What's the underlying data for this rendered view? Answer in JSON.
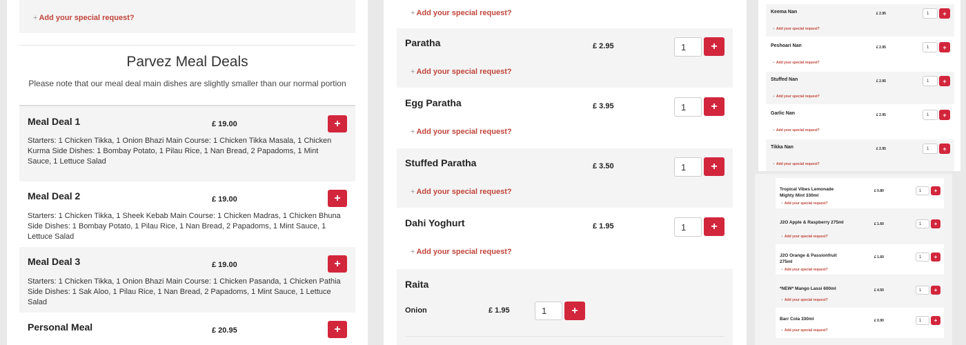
{
  "common": {
    "special_request": "Add your special request?",
    "plus_glyph": "+",
    "add_glyph": "+"
  },
  "meal_deals": {
    "title": "Parvez Meal Deals",
    "note": "Please note that our meal deal main dishes are slightly smaller than our normal portion",
    "items": [
      {
        "name": "Meal Deal 1",
        "price": "£ 19.00",
        "desc": "Starters: 1 Chicken Tikka, 1 Onion Bhazi Main Course: 1 Chicken Tikka Masala, 1 Chicken Kurma Side Dishes: 1 Bombay Potato, 1 Pilau Rice, 1 Nan Bread, 2 Papadoms, 1 Mint Sauce, 1 Lettuce Salad"
      },
      {
        "name": "Meal Deal 2",
        "price": "£ 19.00",
        "desc": "Starters: 1 Chicken Tikka, 1 Sheek Kebab Main Course: 1 Chicken Madras, 1 Chicken Bhuna Side Dishes: 1 Bombay Potato, 1 Pilau Rice, 1 Nan Bread, 2 Papadoms, 1 Mint Sauce, 1 Lettuce Salad"
      },
      {
        "name": "Meal Deal 3",
        "price": "£ 19.00",
        "desc": "Starters: 1 Chicken Tikka, 1 Onion Bhazi Main Course: 1 Chicken Pasanda, 1 Chicken Pathia Side Dishes: 1 Sak Aloo, 1 Pilau Rice, 1 Nan Bread, 2 Papadoms, 1 Mint Sauce, 1 Lettuce Salad"
      },
      {
        "name": "Personal Meal",
        "price": "£ 20.95",
        "desc": ""
      }
    ]
  },
  "breads": {
    "items": [
      {
        "name": "Paratha",
        "price": "£ 2.95",
        "qty": "1"
      },
      {
        "name": "Egg Paratha",
        "price": "£ 3.95",
        "qty": "1"
      },
      {
        "name": "Stuffed Paratha",
        "price": "£ 3.50",
        "qty": "1"
      },
      {
        "name": "Dahi Yoghurt",
        "price": "£ 1.95",
        "qty": "1"
      }
    ],
    "raita": {
      "title": "Raita",
      "option": {
        "name": "Onion",
        "price": "£ 1.95",
        "qty": "1"
      }
    }
  },
  "nans": {
    "items": [
      {
        "name": "Keema Nan",
        "price": "£ 2.95",
        "qty": "1"
      },
      {
        "name": "Peshoari Nan",
        "price": "£ 2.95",
        "qty": "1"
      },
      {
        "name": "Stuffed Nan",
        "price": "£ 2.95",
        "qty": "1"
      },
      {
        "name": "Garlic Nan",
        "price": "£ 2.95",
        "qty": "1"
      },
      {
        "name": "Tikka Nan",
        "price": "£ 2.95",
        "qty": "1"
      }
    ]
  },
  "drinks": {
    "items": [
      {
        "name": "Tropical Vibes Lemonade Mighty Mint 330ml",
        "price": "£ 0.80",
        "qty": "1"
      },
      {
        "name": "J2O Apple & Raspberry 275ml",
        "price": "£ 1.60",
        "qty": "1"
      },
      {
        "name": "J2O Orange & Passionfruit 275ml",
        "price": "£ 1.60",
        "qty": "1"
      },
      {
        "name": "*NEW* Mango Lassi 600ml",
        "price": "£ 4.50",
        "qty": "1"
      },
      {
        "name": "Barr Cola 330ml",
        "price": "£ 0.90",
        "qty": "1"
      }
    ]
  }
}
